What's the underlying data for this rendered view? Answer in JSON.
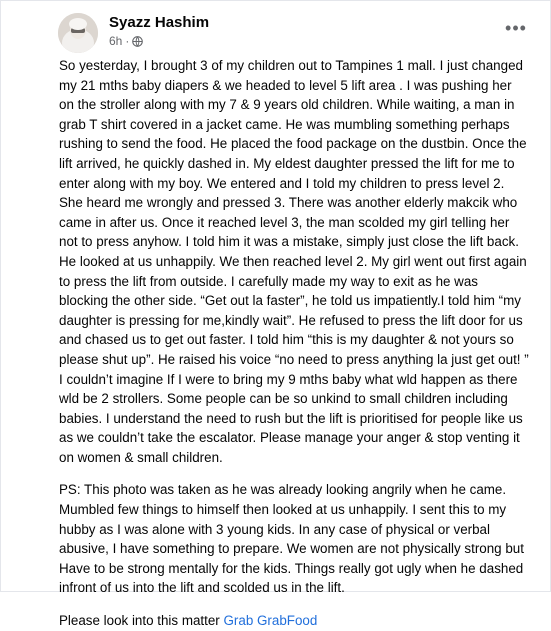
{
  "post": {
    "author": "Syazz Hashim",
    "timestamp": "6h",
    "privacy_icon": "globe-icon",
    "more_icon": "more-options-icon",
    "paragraph1": "So yesterday, I brought 3 of my children out to Tampines 1 mall. I just changed my 21 mths baby diapers & we headed to level 5 lift area . I was pushing her on the stroller along with my 7 & 9 years old children. While waiting, a man in grab T shirt covered in a jacket came. He was mumbling something perhaps rushing to send the food. He placed the food package on the dustbin. Once the lift arrived, he quickly dashed in. My eldest daughter pressed the lift for me to enter along with my boy. We entered and I told my children to press level 2. She heard me wrongly and pressed 3. There was another elderly makcik who came in after us. Once it reached level 3, the man scolded my girl telling her not to press anyhow. I told him it was a mistake, simply just close the lift back. He looked at us unhappily. We then reached level 2. My girl went out first again to press the lift from outside. I carefully made my way to exit as he was blocking the other side. “Get out la faster”, he told us impatiently.I told him “my daughter is pressing for me,kindly wait”. He refused to press the lift door for us and chased us to get out faster. I told him “this is my daughter & not yours so please shut up”. He raised his voice “no need to press anything la just get out! ” I couldn’t imagine If I were to bring my 9 mths baby what wld happen as there wld be 2 strollers. Some people can be so unkind to small children including babies. I understand the need to rush but the lift is prioritised for people like us as we couldn’t take the escalator. Please manage your anger & stop venting it on women & small children.",
    "paragraph2": "PS: This photo was taken as he was already looking angrily when he came. Mumbled few things to himself then looked at us unhappily. I sent this to my hubby as I was alone with 3 young kids. In any case of physical or verbal abusive, I have something to prepare. We women are not physically strong but Have to be strong mentally for the kids. Things really got ugly when he dashed infront of us into the lift and scolded us in the lift.",
    "paragraph3_text": "Please look into this matter ",
    "mention1": "Grab",
    "mention2": "GrabFood"
  },
  "colors": {
    "link": "#216fdb",
    "meta": "#65676b",
    "text": "#050505"
  }
}
